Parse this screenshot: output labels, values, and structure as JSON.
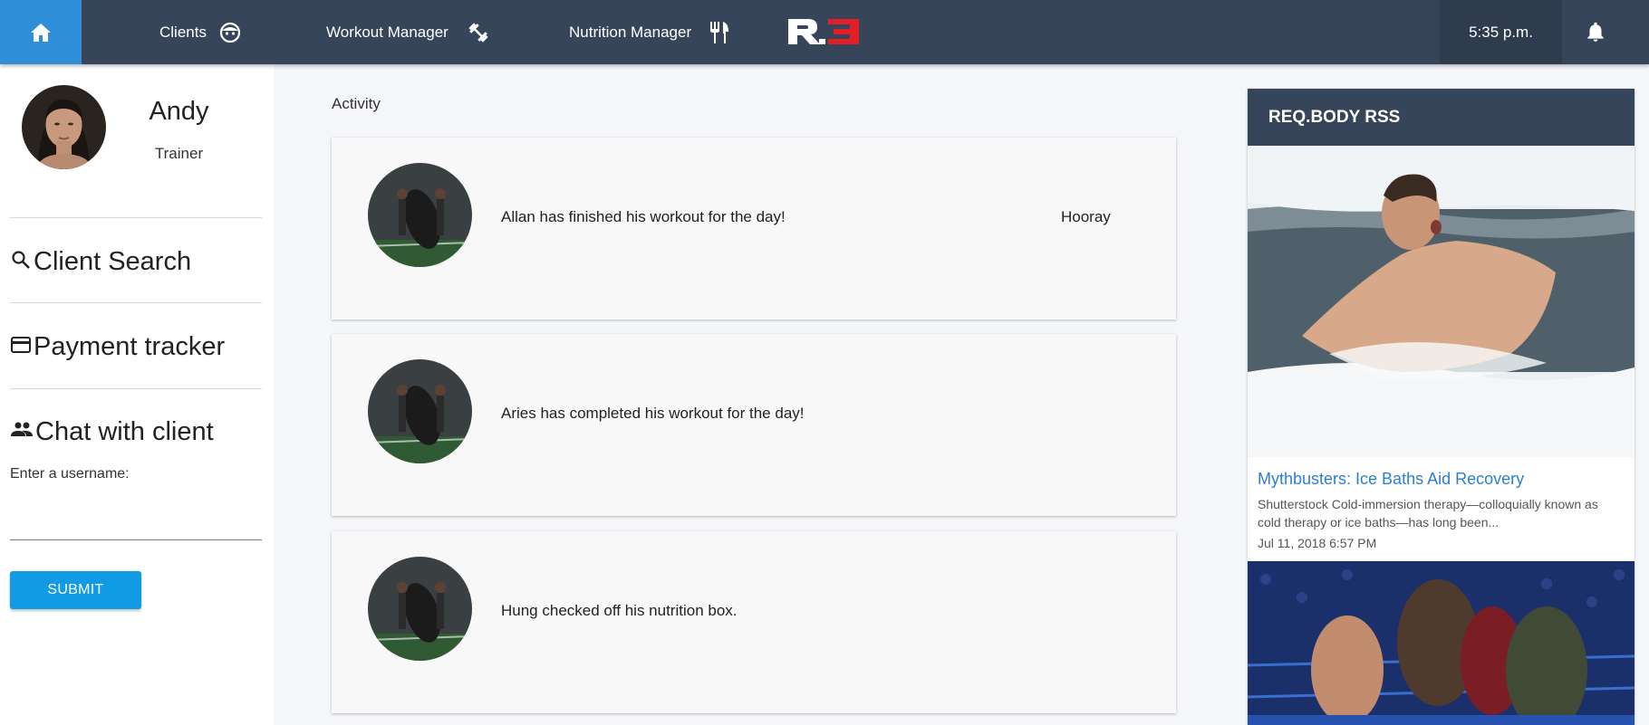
{
  "nav": {
    "home_icon": "home-icon",
    "items": [
      {
        "label": "Clients",
        "icon": "face-icon"
      },
      {
        "label": "Workout Manager",
        "icon": "fitness-icon"
      },
      {
        "label": "Nutrition Manager",
        "icon": "restaurant-icon"
      }
    ],
    "logo_text": "R3",
    "time": "5:35 p.m.",
    "bell_icon": "bell-icon"
  },
  "user": {
    "name": "Andy",
    "role": "Trainer"
  },
  "sidebar": {
    "links": [
      {
        "label": "Client Search",
        "icon": "search-icon"
      },
      {
        "label": "Payment tracker",
        "icon": "credit-card-icon"
      },
      {
        "label": "Chat with client",
        "icon": "people-icon"
      }
    ],
    "username_label": "Enter a username:",
    "username_value": "",
    "submit_label": "SUBMIT"
  },
  "activity": {
    "title": "Activity",
    "items": [
      {
        "text": "Allan has finished his workout for the day!",
        "extra": "Hooray"
      },
      {
        "text": "Aries has completed his workout for the day!",
        "extra": ""
      },
      {
        "text": "Hung checked off his nutrition box.",
        "extra": ""
      }
    ]
  },
  "rss": {
    "title": "REQ.BODY RSS",
    "article": {
      "title": "Mythbusters: Ice Baths Aid Recovery",
      "description": "Shutterstock Cold-immersion therapy—colloquially known as cold therapy or ice baths—has long been...",
      "date": "Jul 11, 2018 6:57 PM"
    }
  },
  "colors": {
    "nav_bg": "#364559",
    "home_active": "#2e8fd8",
    "submit": "#119be5",
    "link": "#2c7fd0",
    "logo_red": "#e21e26"
  }
}
